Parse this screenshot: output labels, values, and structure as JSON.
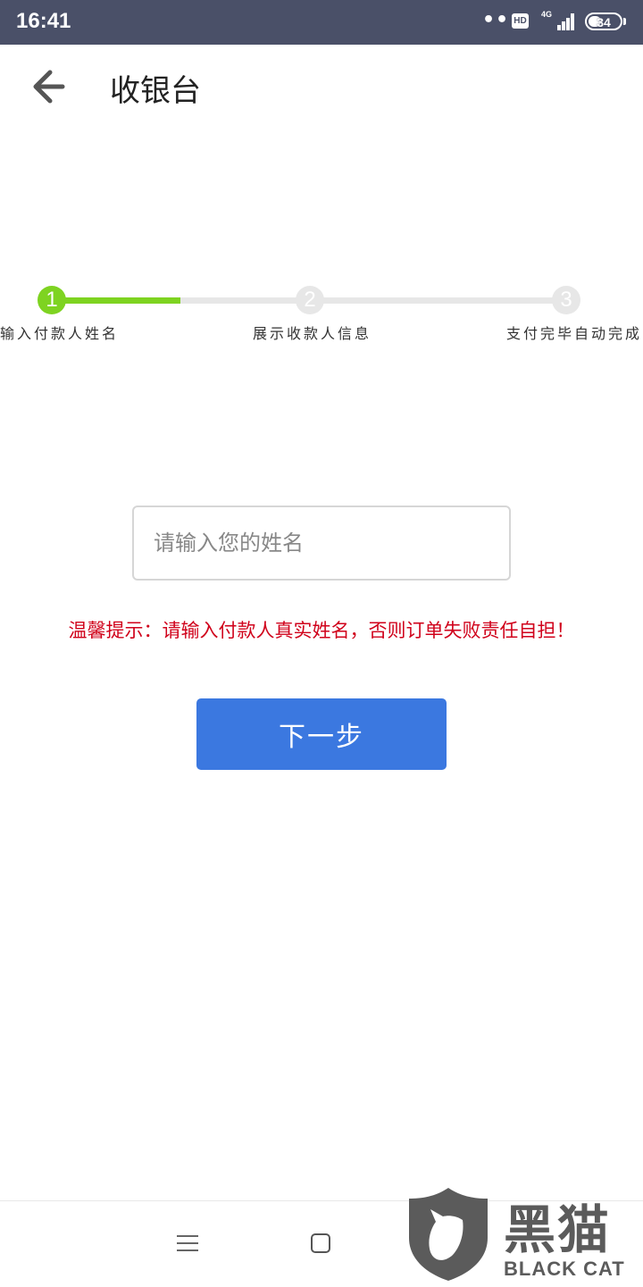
{
  "status_bar": {
    "time": "16:41",
    "dots": "•••",
    "hd": "HD",
    "network": "4G",
    "battery": "34"
  },
  "header": {
    "title": "收银台"
  },
  "steps": {
    "progress_fraction": 0.25,
    "items": [
      {
        "number": "1",
        "label": "输入付款人姓名",
        "active": true
      },
      {
        "number": "2",
        "label": "展示收款人信息",
        "active": false
      },
      {
        "number": "3",
        "label": "支付完毕自动完成",
        "active": false
      }
    ]
  },
  "form": {
    "name_input": {
      "value": "",
      "placeholder": "请输入您的姓名"
    },
    "warning": "温馨提示：请输入付款人真实姓名，否则订单失败责任自担！",
    "next_label": "下一步"
  },
  "colors": {
    "status_bar": "#4a5068",
    "progress_active": "#7ed321",
    "progress_inactive": "#e7e7e7",
    "warning": "#d0021b",
    "primary_button": "#3b78e0"
  },
  "watermark": {
    "cn": "黑猫",
    "en": "BLACK CAT"
  }
}
